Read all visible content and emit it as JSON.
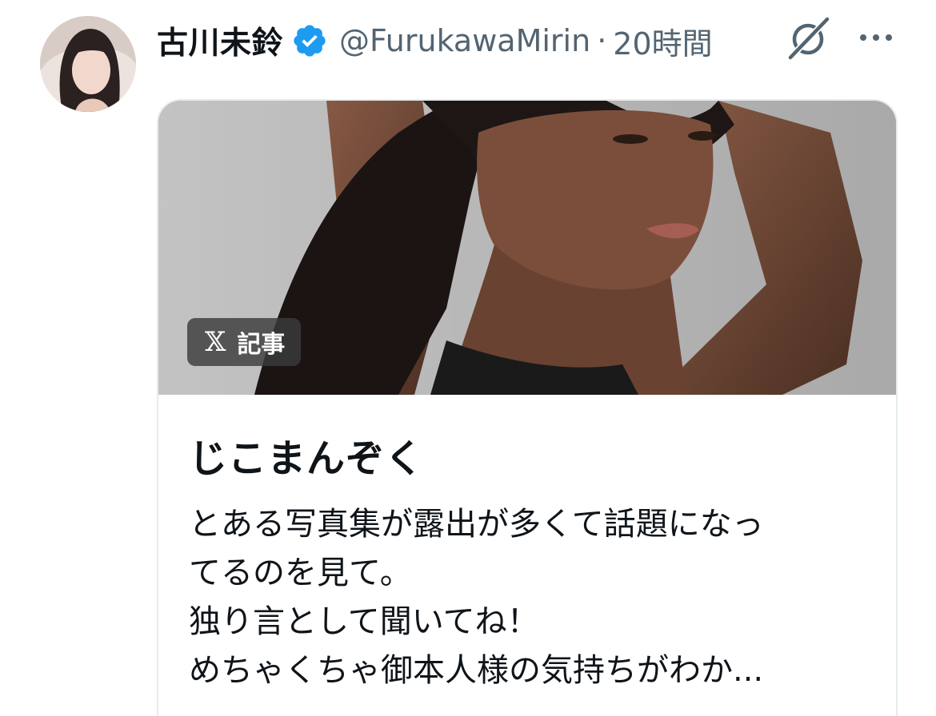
{
  "post": {
    "author_name": "古川未鈴",
    "handle": "@FurukawaMirin",
    "separator": "·",
    "time": "20時間",
    "icons": {
      "avatar": "profile-photo",
      "verified": "verified-badge-icon",
      "grok": "grok-icon",
      "more": "more-icon"
    },
    "colors": {
      "verified": "#1d9bf0",
      "muted_text": "#536471",
      "text": "#0f1419"
    }
  },
  "article_card": {
    "badge_x": "𝕏",
    "badge_label": "記事",
    "title": "じこまんぞく",
    "body_lines": [
      "とある写真集が露出が多くて話題になっ",
      "てるのを見て。",
      "独り言として聞いてね！",
      "めちゃくちゃ御本人様の気持ちがわか..."
    ]
  }
}
